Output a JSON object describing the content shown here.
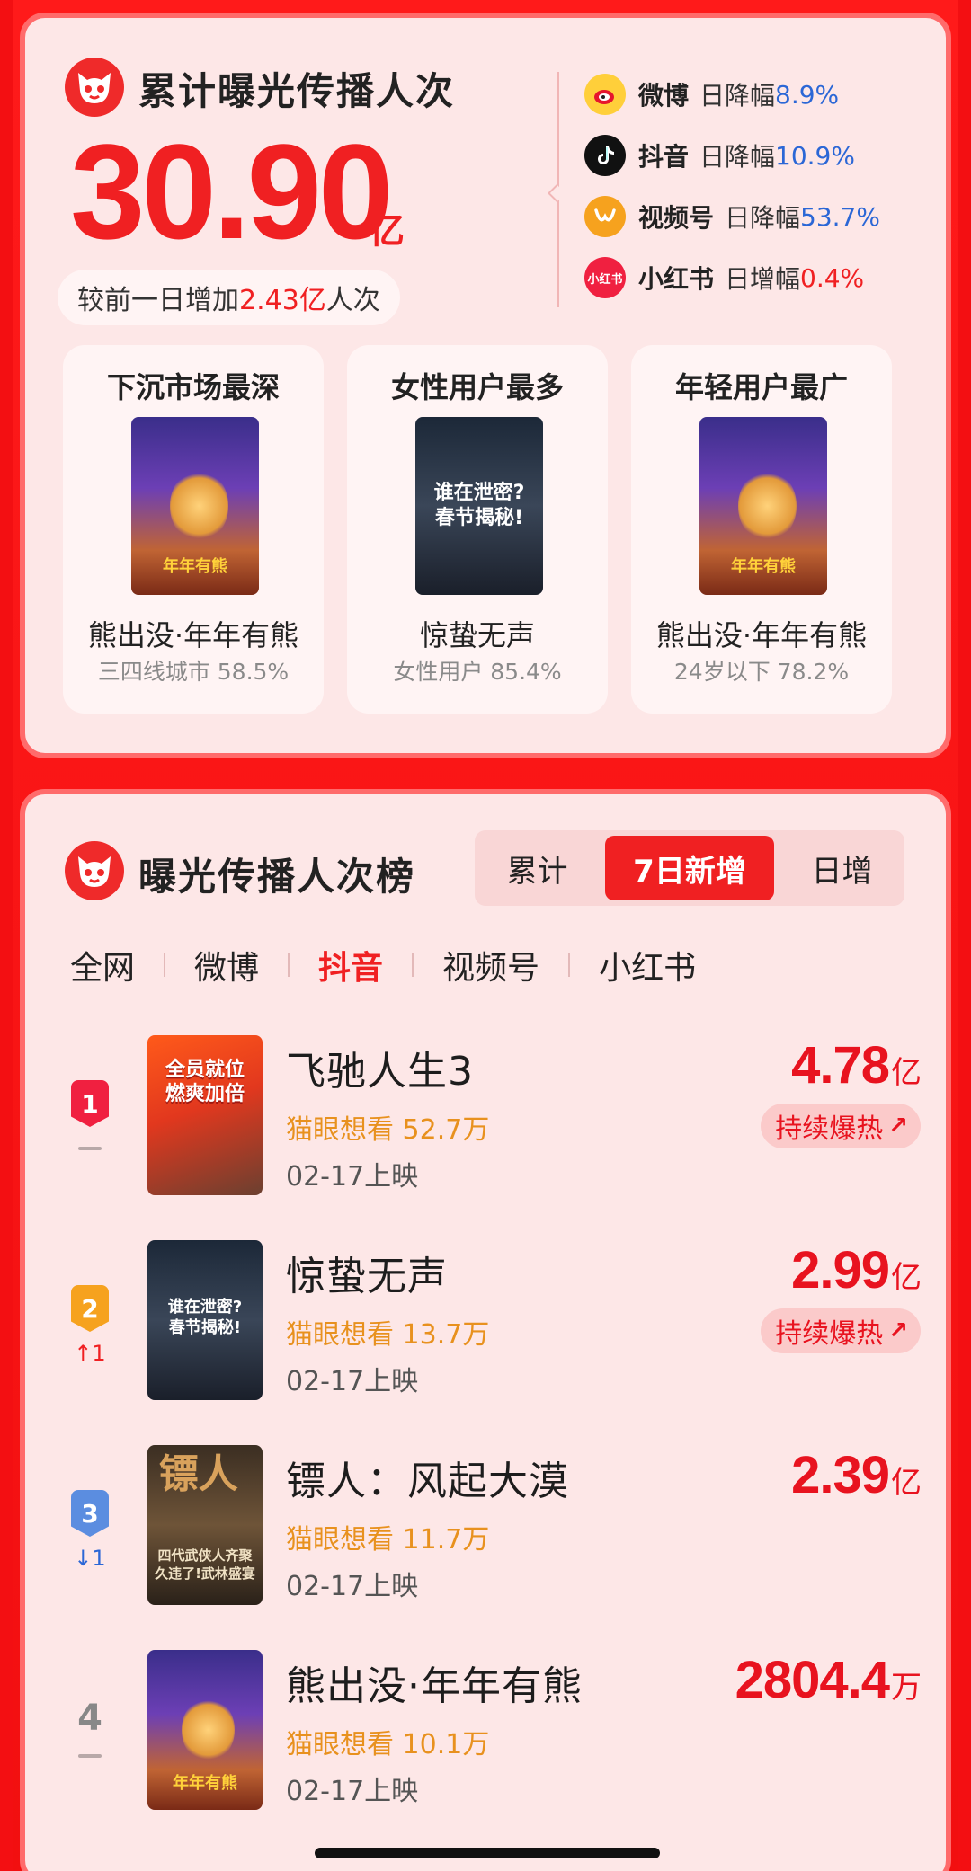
{
  "summary": {
    "title": "累计曝光传播人次",
    "total_value": "30.90",
    "total_unit": "亿",
    "delta_prefix": "较前一日增加",
    "delta_value": "2.43亿",
    "delta_suffix": "人次"
  },
  "platforms": [
    {
      "name": "微博",
      "desc": "日降幅",
      "pct": "8.9%",
      "icon": "weibo-icon",
      "color": "#ffcf3a"
    },
    {
      "name": "抖音",
      "desc": "日降幅",
      "pct": "10.9%",
      "icon": "douyin-icon",
      "color": "#111111"
    },
    {
      "name": "视频号",
      "desc": "日降幅",
      "pct": "53.7%",
      "icon": "channels-icon",
      "color": "#f6a21e"
    },
    {
      "name": "小红书",
      "desc": "日增幅",
      "pct": "0.4%",
      "icon": "xiaohongshu-icon",
      "color": "#f02040",
      "icon_text": "小红书"
    }
  ],
  "features": [
    {
      "title": "下沉市场最深",
      "movie": "熊出没·年年有熊",
      "sub": "三四线城市 58.5%",
      "poster_text": "年年有熊"
    },
    {
      "title": "女性用户最多",
      "movie": "惊蛰无声",
      "sub": "女性用户 85.4%",
      "poster_text": "谁在泄密?\n春节揭秘!"
    },
    {
      "title": "年轻用户最广",
      "movie": "熊出没·年年有熊",
      "sub": "24岁以下 78.2%",
      "poster_text": "年年有熊"
    }
  ],
  "ranking": {
    "title": "曝光传播人次榜",
    "segments": [
      "累计",
      "7日新增",
      "日增"
    ],
    "active_segment": "7日新增",
    "tabs": [
      "全网",
      "微博",
      "抖音",
      "视频号",
      "小红书"
    ],
    "active_tab": "抖音",
    "rows": [
      {
        "rank": "1",
        "change": "",
        "title": "飞驰人生3",
        "want": "猫眼想看 52.7万",
        "date": "02-17上映",
        "value": "4.78",
        "unit": "亿",
        "tag": "持续爆热",
        "poster_text": "全员就位\n燃爽加倍"
      },
      {
        "rank": "2",
        "change": "↑1",
        "title": "惊蛰无声",
        "want": "猫眼想看 13.7万",
        "date": "02-17上映",
        "value": "2.99",
        "unit": "亿",
        "tag": "持续爆热",
        "poster_text": "谁在泄密?\n春节揭秘!"
      },
      {
        "rank": "3",
        "change": "↓1",
        "title": "镖人：风起大漠",
        "want": "猫眼想看 11.7万",
        "date": "02-17上映",
        "value": "2.39",
        "unit": "亿",
        "tag": "",
        "poster_text": "四代武侠人齐聚\n久违了!武林盛宴",
        "poster_big": "镖人"
      },
      {
        "rank": "4",
        "change": "",
        "title": "熊出没·年年有熊",
        "want": "猫眼想看 10.1万",
        "date": "02-17上映",
        "value": "2804.4",
        "unit": "万",
        "tag": "",
        "poster_text": "年年有熊"
      }
    ]
  }
}
